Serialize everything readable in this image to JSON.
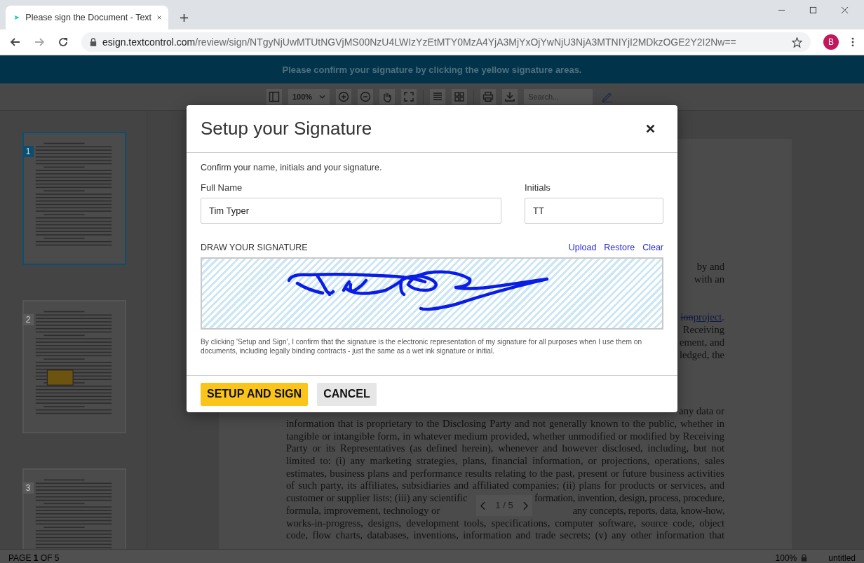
{
  "browser": {
    "tab_title": "Please sign the Document - Text",
    "url_host": "esign.textcontrol.com",
    "url_path": "/review/sign/NTgyNjUwMTUtNGVjMS00NzU4LWIzYzEtMTY0MzA4YjA3MjYxOjYwNjU3NjA3MTNIYjI2MDkzOGE2Y2I2Nw==",
    "profile_initial": "B"
  },
  "banner": "Please confirm your signature by clicking the yellow signature areas.",
  "toolbar": {
    "zoom": "100%",
    "search_placeholder": "Search..."
  },
  "thumbnails": [
    {
      "number": "1",
      "selected": true,
      "signature_field": false
    },
    {
      "number": "2",
      "selected": false,
      "signature_field": true
    },
    {
      "number": "3",
      "selected": false,
      "signature_field": false
    }
  ],
  "document": {
    "fragment_paragraphs": [
      {
        "lines": [
          {
            "text": "by and"
          },
          {
            "text": "with an"
          }
        ]
      },
      {
        "lines": [
          {
            "deleted": "ion",
            "link": "project",
            "text": "."
          },
          {
            "text": "Receiving"
          },
          {
            "text": "ement, and"
          },
          {
            "text": "ledged, the"
          }
        ]
      }
    ],
    "first_line": "any data or",
    "lines": [
      {
        "text": "information that is proprietary to the Disclosing Party and not generally known to the public, whether in"
      },
      {
        "text": "tangible or intangible form, in whatever medium provided, whether unmodified or modified by Receiving"
      },
      {
        "text": "Party or its Representatives (as defined herein), whenever and however disclosed, including, but not"
      },
      {
        "text": "limited to: (i) any marketing strategies, plans, financial information, or projections, operations, sales"
      },
      {
        "text": "estimates, business plans and performance results relating to the past, present or future business activities"
      },
      {
        "text": "of such party, its affiliates, subsidiaries and affiliated companies; (ii) plans for products or services, and"
      },
      {
        "text": "customer or supplier lists; (iii) any scientific",
        "after": "formation, invention, design, process, procedure,"
      },
      {
        "text": "formula, improvement, technology or",
        "after": "any concepts, reports, data, know-how,"
      },
      {
        "text": "works-in-progress, designs, development tools, specifications, computer software, source code, object"
      },
      {
        "text": "code, flow charts, databases, inventions, information and trade secrets; (v) any other information that"
      }
    ],
    "pager": "1 / 5"
  },
  "dialog": {
    "title": "Setup your Signature",
    "intro": "Confirm your name, initials and your signature.",
    "full_name": {
      "label": "Full Name",
      "value": "Tim Typer"
    },
    "initials": {
      "label": "Initials",
      "value": "TT"
    },
    "signature_label": "DRAW YOUR SIGNATURE",
    "links": [
      "Upload",
      "Restore",
      "Clear"
    ],
    "disclaimer": "By clicking 'Setup and Sign', I confirm that the signature is the electronic representation of my signature for all purposes when I use them on documents, including legally binding contracts - just the same as a wet ink signature or initial.",
    "buttons": [
      {
        "label": "SETUP AND SIGN",
        "kind": "primary"
      },
      {
        "label": "CANCEL",
        "kind": "secondary"
      }
    ]
  },
  "status_bar": {
    "page": "PAGE **1** OF 5",
    "zoom": "100%",
    "file": "untitled"
  }
}
